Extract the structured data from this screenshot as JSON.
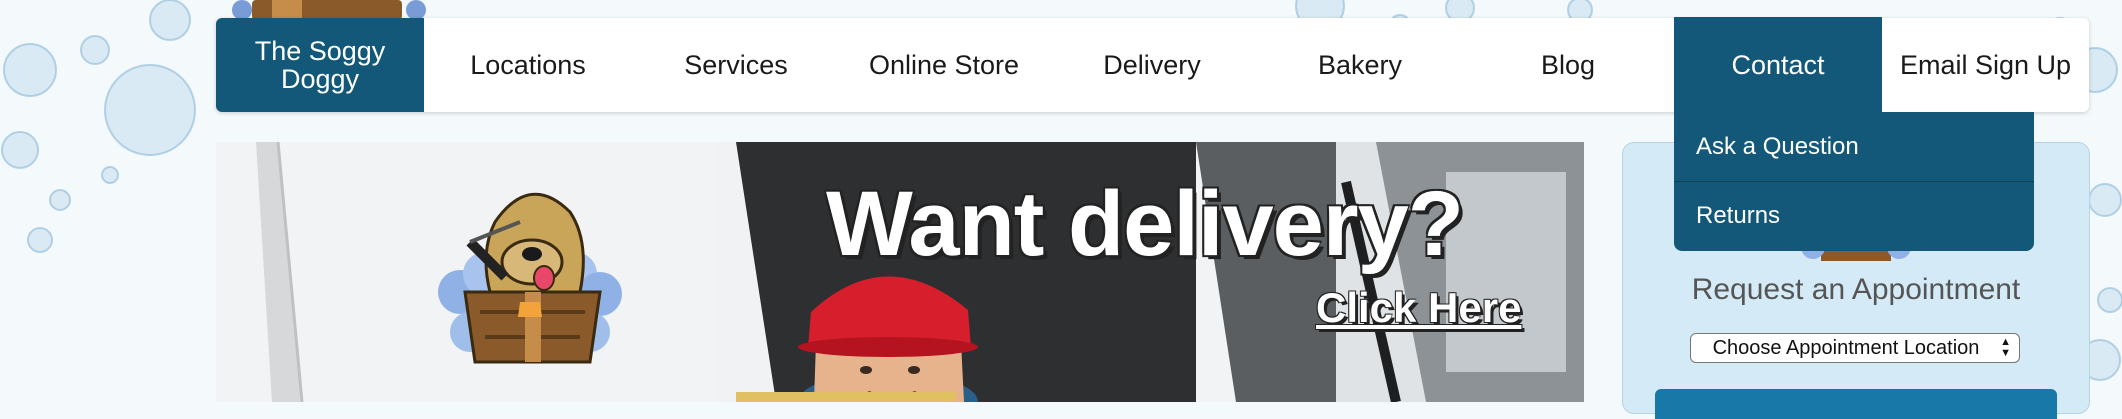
{
  "nav": {
    "brand": "The Soggy Doggy",
    "items": [
      {
        "label": "Locations"
      },
      {
        "label": "Services"
      },
      {
        "label": "Online Store"
      },
      {
        "label": "Delivery"
      },
      {
        "label": "Bakery"
      },
      {
        "label": "Blog"
      },
      {
        "label": "Contact",
        "active": true
      },
      {
        "label": "Email Sign Up"
      }
    ]
  },
  "dropdown": {
    "items": [
      {
        "label": "Ask a Question"
      },
      {
        "label": "Returns"
      }
    ]
  },
  "hero": {
    "headline": "Want delivery?",
    "link": "Click Here"
  },
  "sidebar": {
    "title": "Request an Appointment",
    "select_value": "Choose Appointment Location"
  },
  "colors": {
    "brand": "#135878",
    "accent_button": "#1878a8",
    "card_bg": "#d4ebf7",
    "hero_cap": "#e53238"
  }
}
